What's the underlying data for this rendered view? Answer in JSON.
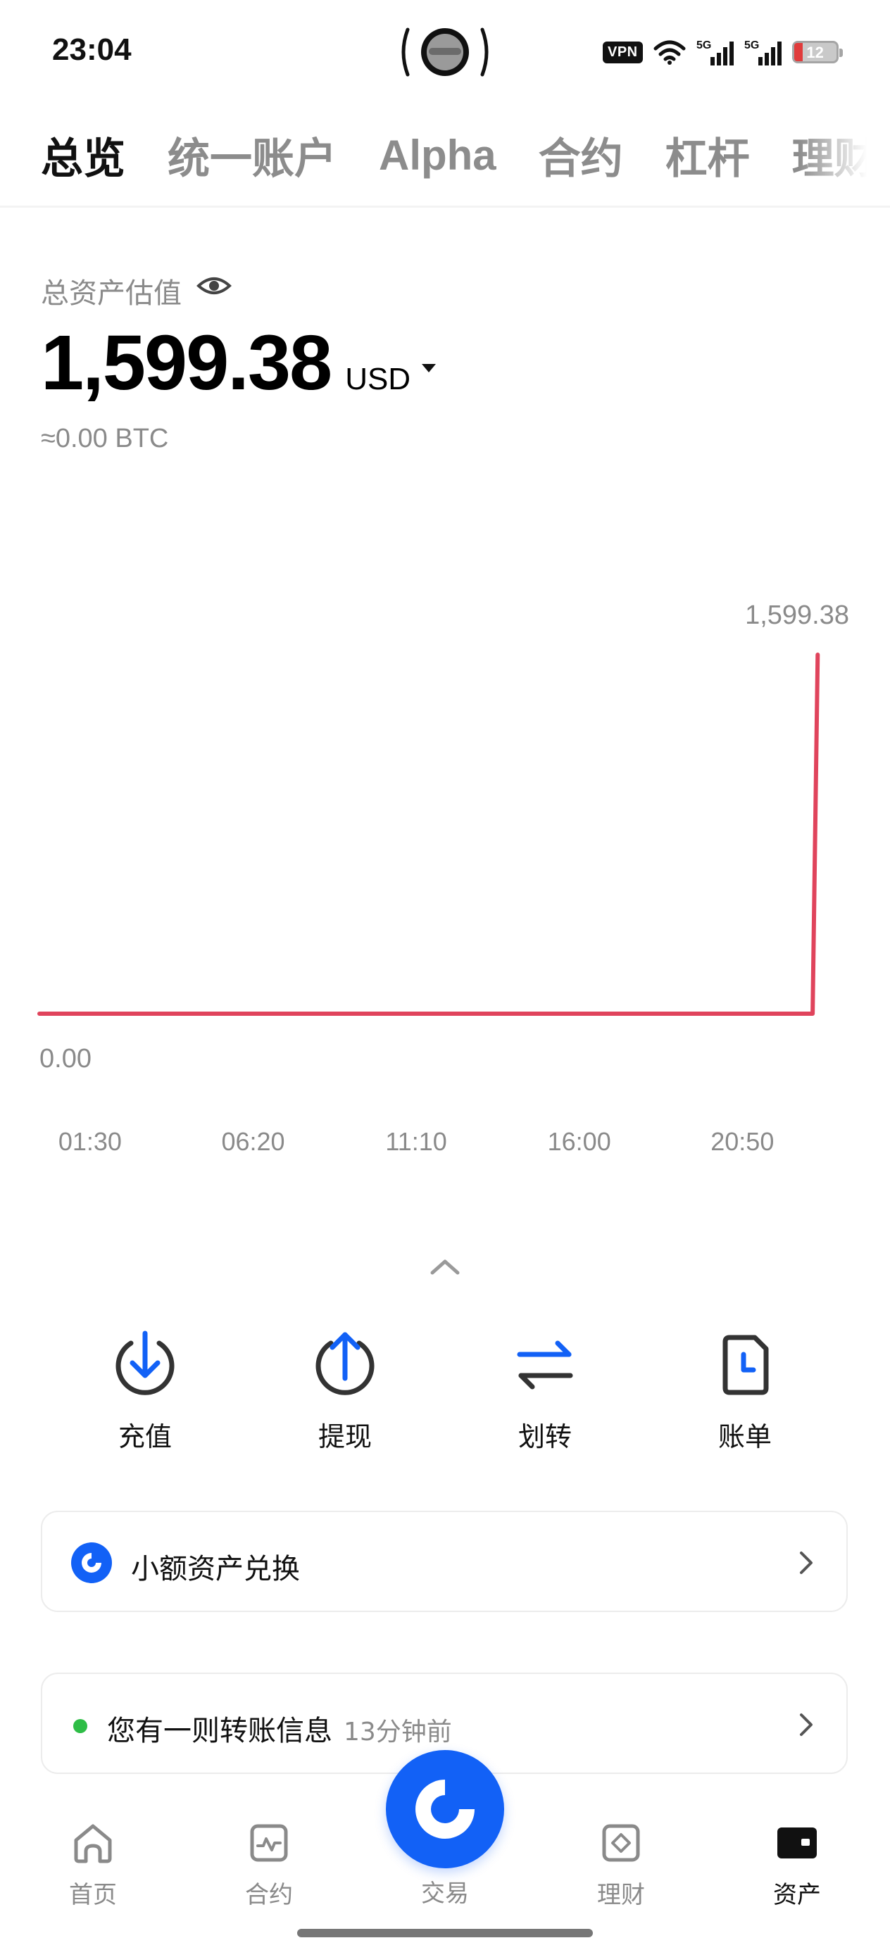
{
  "status_bar": {
    "time": "23:04",
    "vpn_label": "VPN",
    "signal_labels": [
      "5G",
      "5G"
    ],
    "battery_level": "12",
    "icons": [
      "camera-cutout-icon",
      "wifi-icon",
      "cellular-signal-icon",
      "battery-icon"
    ]
  },
  "tabs": [
    {
      "label": "总览",
      "active": true
    },
    {
      "label": "统一账户",
      "active": false
    },
    {
      "label": "Alpha",
      "active": false
    },
    {
      "label": "合约",
      "active": false
    },
    {
      "label": "杠杆",
      "active": false
    },
    {
      "label": "理财",
      "active": false
    }
  ],
  "overview": {
    "asset_label": "总资产估值",
    "balance": "1,599.38",
    "currency": "USD",
    "btc_equivalent": "≈0.00 BTC"
  },
  "chart_data": {
    "type": "line",
    "x_tick_labels": [
      "01:30",
      "06:20",
      "11:10",
      "16:00",
      "20:50"
    ],
    "max_label": "1,599.38",
    "min_label": "0.00",
    "ylim": [
      0,
      1599.38
    ],
    "series": [
      {
        "color": "#e0445c",
        "points": [
          {
            "x": "00:00",
            "y": 0
          },
          {
            "x": "22:55",
            "y": 0
          },
          {
            "x": "23:04",
            "y": 1599.38
          }
        ]
      }
    ],
    "grid": false
  },
  "actions": [
    {
      "label": "充值",
      "icon": "deposit-arrow-down-icon"
    },
    {
      "label": "提现",
      "icon": "withdraw-arrow-up-icon"
    },
    {
      "label": "划转",
      "icon": "transfer-arrows-icon"
    },
    {
      "label": "账单",
      "icon": "bill-clock-icon"
    }
  ],
  "cards": {
    "convert": {
      "label": "小额资产兑换",
      "icon": "small-asset-convert-icon"
    },
    "transfer": {
      "message": "您有一则转账信息",
      "time": "13分钟前"
    }
  },
  "bottom_nav": [
    {
      "label": "首页",
      "icon": "home-icon",
      "active": false
    },
    {
      "label": "合约",
      "icon": "futures-chart-icon",
      "active": false
    },
    {
      "label": "交易",
      "icon": "trade-logo-icon",
      "active": false
    },
    {
      "label": "理财",
      "icon": "earn-diamond-icon",
      "active": false
    },
    {
      "label": "资产",
      "icon": "wallet-icon",
      "active": true
    }
  ],
  "colors": {
    "accent_blue": "#1261f6",
    "chart_line": "#e0445c",
    "status_green": "#2ebd46",
    "muted_text": "#8a8a8a"
  }
}
